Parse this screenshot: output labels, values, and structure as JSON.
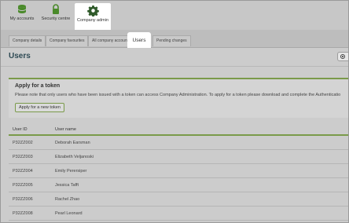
{
  "topnav": {
    "items": [
      {
        "label": "My accounts",
        "icon": "database-icon"
      },
      {
        "label": "Security centre",
        "icon": "lock-icon"
      },
      {
        "label": "Company admin",
        "icon": "gear-icon"
      }
    ]
  },
  "tabs": [
    {
      "label": "Company details"
    },
    {
      "label": "Company favourites"
    },
    {
      "label": "All company accounts"
    },
    {
      "label": "Users"
    },
    {
      "label": "Pending changes"
    }
  ],
  "page": {
    "title": "Users"
  },
  "token_panel": {
    "title": "Apply for a token",
    "text": "Please note that only users who have been issued with a token can access Company Administration. To apply for a token please download and complete the Authenticatio",
    "button_label": "Apply for a new token"
  },
  "users_table": {
    "headers": [
      "User ID",
      "User name"
    ],
    "rows": [
      [
        "P32ZZ002",
        "Deborah Earsman"
      ],
      [
        "P32ZZ003",
        "Elizabeth Veljanoski"
      ],
      [
        "P32ZZ004",
        "Emily Perersiper"
      ],
      [
        "P32ZZ005",
        "Jessica Tafft"
      ],
      [
        "P32ZZ006",
        "Rachel Zhao"
      ],
      [
        "P32ZZ008",
        "Pearl Leonard"
      ]
    ]
  },
  "colors": {
    "accent_green": "#7a9a4a",
    "nav_icon_green": "#4a8a2a",
    "title_color": "#2e4a54"
  }
}
